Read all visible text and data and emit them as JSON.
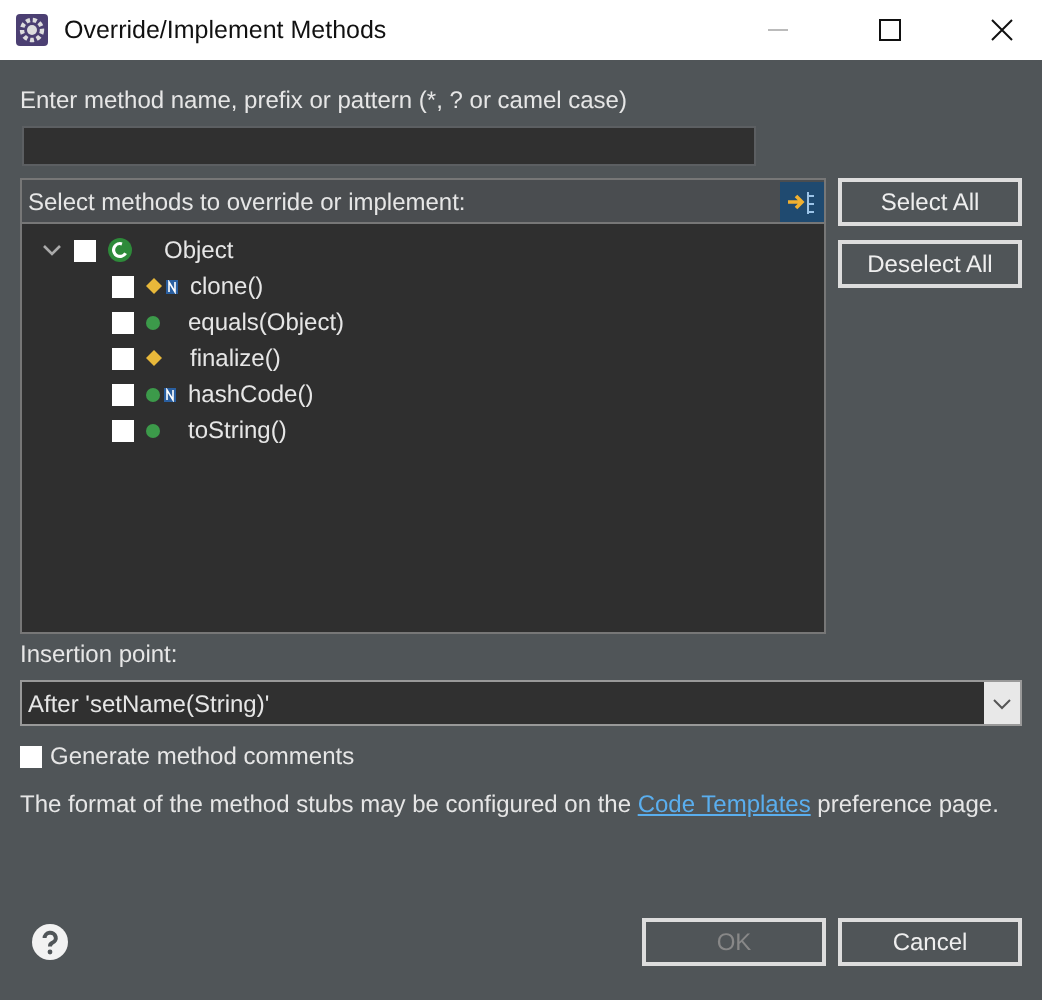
{
  "window": {
    "title": "Override/Implement Methods"
  },
  "filter": {
    "label": "Enter method name, prefix or pattern (*, ? or camel case)"
  },
  "tree": {
    "header": "Select methods to override or implement:",
    "root": {
      "label": "Object",
      "expanded": true,
      "checked": false,
      "children": [
        {
          "label": "clone()",
          "kind": "protected",
          "native": true,
          "checked": false
        },
        {
          "label": "equals(Object)",
          "kind": "public",
          "native": false,
          "checked": false
        },
        {
          "label": "finalize()",
          "kind": "protected",
          "native": false,
          "checked": false
        },
        {
          "label": "hashCode()",
          "kind": "public",
          "native": true,
          "checked": false
        },
        {
          "label": "toString()",
          "kind": "public",
          "native": false,
          "checked": false
        }
      ]
    }
  },
  "side_buttons": [
    "Select All",
    "Deselect All"
  ],
  "insertion": {
    "label": "Insertion point:",
    "value": "After 'setName(String)'"
  },
  "generate_comments": {
    "label": "Generate method comments",
    "checked": false
  },
  "info": {
    "before": "The format of the method stubs may be configured on the ",
    "link": "Code Templates",
    "after": " preference page."
  },
  "buttons": [
    {
      "label": "OK",
      "disabled": true
    },
    {
      "label": "Cancel",
      "disabled": false
    }
  ]
}
